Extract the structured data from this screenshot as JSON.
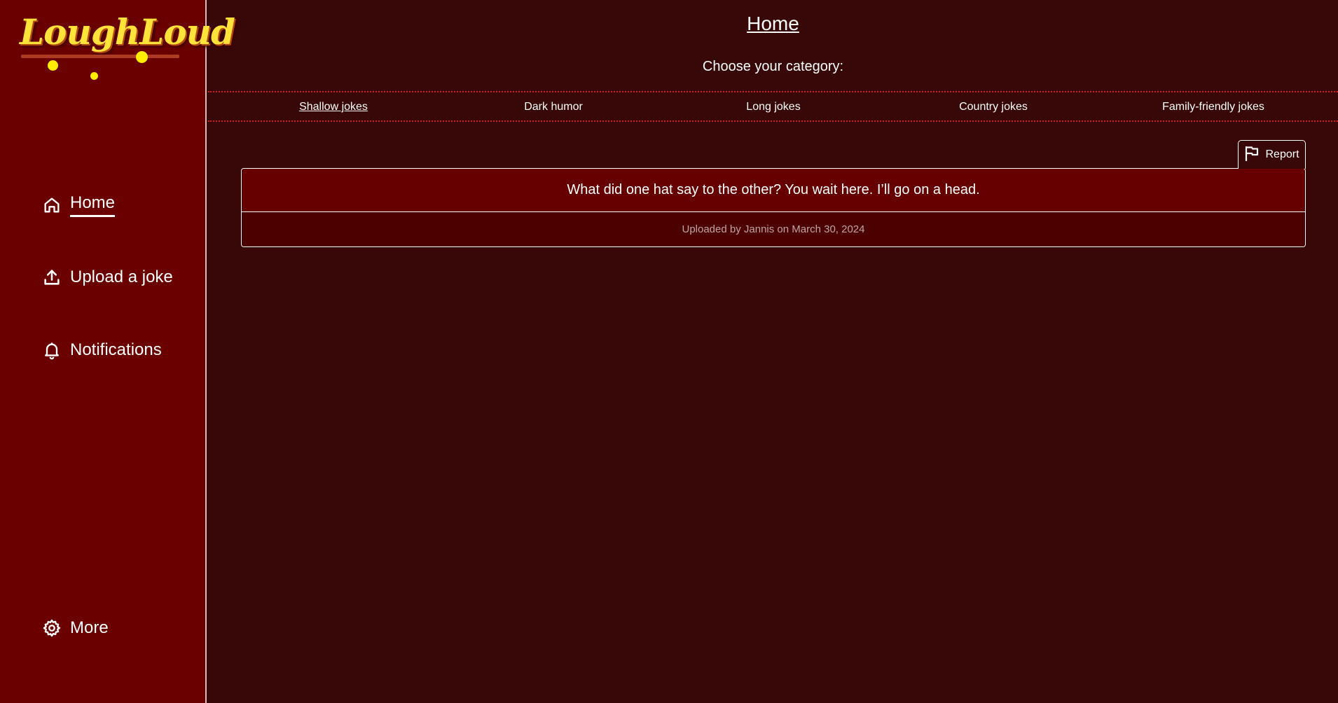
{
  "brand": {
    "logo_text": "LoughLoud",
    "logo_color": "#ffe23a"
  },
  "colors": {
    "sidebar_bg": "#6b0000",
    "main_bg": "#380808",
    "card_bg": "#660000",
    "divider": "#d11a1a"
  },
  "sidebar": {
    "items": [
      {
        "label": "Home",
        "icon": "home-icon",
        "active": true
      },
      {
        "label": "Upload a joke",
        "icon": "upload-icon",
        "active": false
      },
      {
        "label": "Notifications",
        "icon": "bell-icon",
        "active": false
      }
    ],
    "more": {
      "label": "More",
      "icon": "gear-icon"
    }
  },
  "main": {
    "title": "Home",
    "subtitle": "Choose your category:",
    "categories": [
      {
        "label": "Shallow jokes",
        "active": true
      },
      {
        "label": "Dark humor",
        "active": false
      },
      {
        "label": "Long jokes",
        "active": false
      },
      {
        "label": "Country jokes",
        "active": false
      },
      {
        "label": "Family-friendly jokes",
        "active": false
      }
    ],
    "report": {
      "label": "Report",
      "icon": "flag-icon"
    },
    "joke": {
      "text": "What did one hat say to the other? You wait here. I’ll go on a head.",
      "meta": "Uploaded by Jannis on March 30, 2024"
    }
  }
}
